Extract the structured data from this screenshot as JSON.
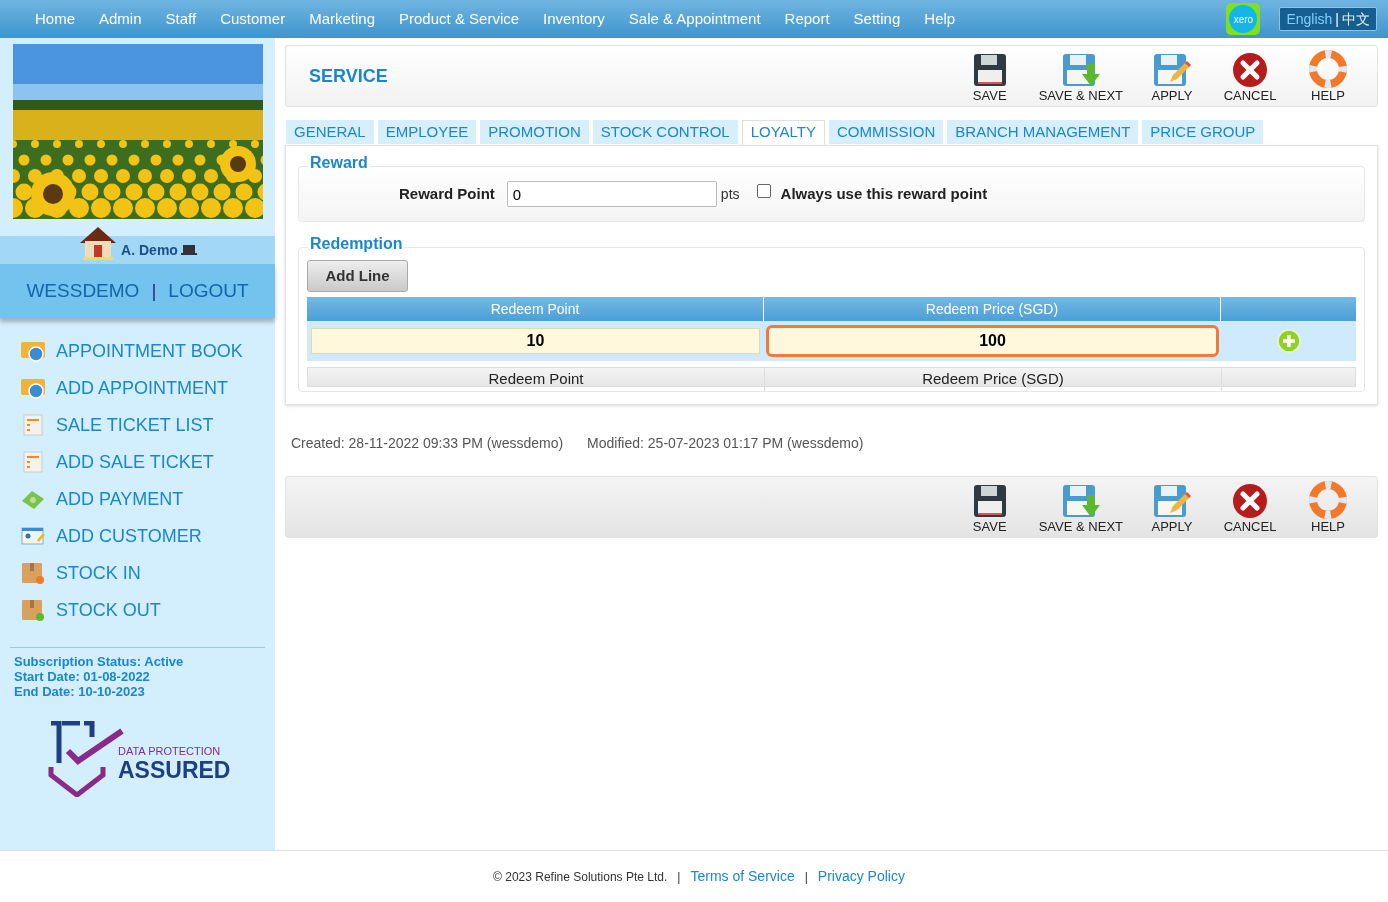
{
  "nav": {
    "items": [
      "Home",
      "Admin",
      "Staff",
      "Customer",
      "Marketing",
      "Product & Service",
      "Inventory",
      "Sale & Appointment",
      "Report",
      "Setting",
      "Help"
    ],
    "xero": "xero",
    "languages": [
      {
        "label": "English",
        "selected": true
      },
      {
        "label": "中文",
        "selected": false
      }
    ],
    "language_separator": "|"
  },
  "sidebar": {
    "user": "A. Demo",
    "account": "WESSDEMO",
    "separator": "|",
    "logout": "LOGOUT",
    "menu": [
      {
        "label": "APPOINTMENT BOOK",
        "kind": "calendar"
      },
      {
        "label": "ADD APPOINTMENT",
        "kind": "calendar"
      },
      {
        "label": "SALE TICKET LIST",
        "kind": "ticket"
      },
      {
        "label": "ADD SALE TICKET",
        "kind": "ticket"
      },
      {
        "label": "ADD PAYMENT",
        "kind": "money"
      },
      {
        "label": "ADD CUSTOMER",
        "kind": "card"
      },
      {
        "label": "STOCK IN",
        "kind": "box-in"
      },
      {
        "label": "STOCK OUT",
        "kind": "box-out"
      }
    ],
    "subscription": [
      "Subscription Status: Active",
      "Start Date: 01-08-2022",
      "End Date: 10-10-2023"
    ],
    "badge": {
      "line1": "DATA PROTECTION",
      "line2": "ASSURED"
    }
  },
  "page": {
    "title": "SERVICE",
    "toolbar": [
      {
        "label": "SAVE",
        "kind": "save"
      },
      {
        "label": "SAVE & NEXT",
        "kind": "save-next"
      },
      {
        "label": "APPLY",
        "kind": "apply"
      },
      {
        "label": "CANCEL",
        "kind": "cancel"
      },
      {
        "label": "HELP",
        "kind": "help"
      }
    ],
    "tabs": [
      {
        "label": "GENERAL",
        "selected": false
      },
      {
        "label": "EMPLOYEE",
        "selected": false
      },
      {
        "label": "PROMOTION",
        "selected": false
      },
      {
        "label": "STOCK CONTROL",
        "selected": false
      },
      {
        "label": "LOYALTY",
        "selected": true
      },
      {
        "label": "COMMISSION",
        "selected": false
      },
      {
        "label": "BRANCH MANAGEMENT",
        "selected": false
      },
      {
        "label": "PRICE GROUP",
        "selected": false
      }
    ],
    "reward": {
      "title": "Reward",
      "label": "Reward Point",
      "value": "0",
      "unit": "pts",
      "checkbox": {
        "label": "Always use this reward point",
        "checked": false
      }
    },
    "redemption": {
      "title": "Redemption",
      "add_line": "Add Line",
      "columns": [
        "Redeem Point",
        "Redeem Price (SGD)"
      ],
      "rows": [
        {
          "point": "10",
          "price": "100",
          "focused": true
        }
      ],
      "footer": [
        "Redeem Point",
        "Redeem Price (SGD)"
      ]
    },
    "created": "Created: 28-11-2022 09:33 PM (wessdemo)",
    "modified": "Modified: 25-07-2023 01:17 PM (wessdemo)",
    "bottom_toolbar": [
      {
        "label": "SAVE",
        "kind": "save"
      },
      {
        "label": "SAVE & NEXT",
        "kind": "save-next"
      },
      {
        "label": "APPLY",
        "kind": "apply"
      },
      {
        "label": "CANCEL",
        "kind": "cancel"
      },
      {
        "label": "HELP",
        "kind": "help"
      }
    ]
  },
  "footer": {
    "copyright": "© 2023 Refine Solutions Pte Ltd.",
    "links": [
      "Terms of Service",
      "Privacy Policy"
    ],
    "separator": "|"
  }
}
